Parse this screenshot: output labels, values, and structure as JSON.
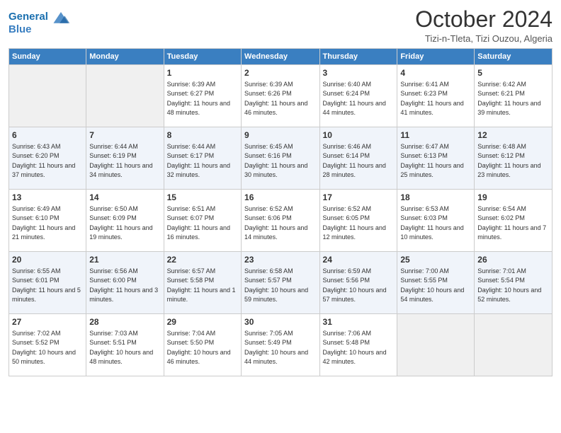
{
  "header": {
    "logo_line1": "General",
    "logo_line2": "Blue",
    "month_title": "October 2024",
    "location": "Tizi-n-Tleta, Tizi Ouzou, Algeria"
  },
  "weekdays": [
    "Sunday",
    "Monday",
    "Tuesday",
    "Wednesday",
    "Thursday",
    "Friday",
    "Saturday"
  ],
  "weeks": [
    [
      {
        "day": "",
        "detail": ""
      },
      {
        "day": "",
        "detail": ""
      },
      {
        "day": "1",
        "detail": "Sunrise: 6:39 AM\nSunset: 6:27 PM\nDaylight: 11 hours and 48 minutes."
      },
      {
        "day": "2",
        "detail": "Sunrise: 6:39 AM\nSunset: 6:26 PM\nDaylight: 11 hours and 46 minutes."
      },
      {
        "day": "3",
        "detail": "Sunrise: 6:40 AM\nSunset: 6:24 PM\nDaylight: 11 hours and 44 minutes."
      },
      {
        "day": "4",
        "detail": "Sunrise: 6:41 AM\nSunset: 6:23 PM\nDaylight: 11 hours and 41 minutes."
      },
      {
        "day": "5",
        "detail": "Sunrise: 6:42 AM\nSunset: 6:21 PM\nDaylight: 11 hours and 39 minutes."
      }
    ],
    [
      {
        "day": "6",
        "detail": "Sunrise: 6:43 AM\nSunset: 6:20 PM\nDaylight: 11 hours and 37 minutes."
      },
      {
        "day": "7",
        "detail": "Sunrise: 6:44 AM\nSunset: 6:19 PM\nDaylight: 11 hours and 34 minutes."
      },
      {
        "day": "8",
        "detail": "Sunrise: 6:44 AM\nSunset: 6:17 PM\nDaylight: 11 hours and 32 minutes."
      },
      {
        "day": "9",
        "detail": "Sunrise: 6:45 AM\nSunset: 6:16 PM\nDaylight: 11 hours and 30 minutes."
      },
      {
        "day": "10",
        "detail": "Sunrise: 6:46 AM\nSunset: 6:14 PM\nDaylight: 11 hours and 28 minutes."
      },
      {
        "day": "11",
        "detail": "Sunrise: 6:47 AM\nSunset: 6:13 PM\nDaylight: 11 hours and 25 minutes."
      },
      {
        "day": "12",
        "detail": "Sunrise: 6:48 AM\nSunset: 6:12 PM\nDaylight: 11 hours and 23 minutes."
      }
    ],
    [
      {
        "day": "13",
        "detail": "Sunrise: 6:49 AM\nSunset: 6:10 PM\nDaylight: 11 hours and 21 minutes."
      },
      {
        "day": "14",
        "detail": "Sunrise: 6:50 AM\nSunset: 6:09 PM\nDaylight: 11 hours and 19 minutes."
      },
      {
        "day": "15",
        "detail": "Sunrise: 6:51 AM\nSunset: 6:07 PM\nDaylight: 11 hours and 16 minutes."
      },
      {
        "day": "16",
        "detail": "Sunrise: 6:52 AM\nSunset: 6:06 PM\nDaylight: 11 hours and 14 minutes."
      },
      {
        "day": "17",
        "detail": "Sunrise: 6:52 AM\nSunset: 6:05 PM\nDaylight: 11 hours and 12 minutes."
      },
      {
        "day": "18",
        "detail": "Sunrise: 6:53 AM\nSunset: 6:03 PM\nDaylight: 11 hours and 10 minutes."
      },
      {
        "day": "19",
        "detail": "Sunrise: 6:54 AM\nSunset: 6:02 PM\nDaylight: 11 hours and 7 minutes."
      }
    ],
    [
      {
        "day": "20",
        "detail": "Sunrise: 6:55 AM\nSunset: 6:01 PM\nDaylight: 11 hours and 5 minutes."
      },
      {
        "day": "21",
        "detail": "Sunrise: 6:56 AM\nSunset: 6:00 PM\nDaylight: 11 hours and 3 minutes."
      },
      {
        "day": "22",
        "detail": "Sunrise: 6:57 AM\nSunset: 5:58 PM\nDaylight: 11 hours and 1 minute."
      },
      {
        "day": "23",
        "detail": "Sunrise: 6:58 AM\nSunset: 5:57 PM\nDaylight: 10 hours and 59 minutes."
      },
      {
        "day": "24",
        "detail": "Sunrise: 6:59 AM\nSunset: 5:56 PM\nDaylight: 10 hours and 57 minutes."
      },
      {
        "day": "25",
        "detail": "Sunrise: 7:00 AM\nSunset: 5:55 PM\nDaylight: 10 hours and 54 minutes."
      },
      {
        "day": "26",
        "detail": "Sunrise: 7:01 AM\nSunset: 5:54 PM\nDaylight: 10 hours and 52 minutes."
      }
    ],
    [
      {
        "day": "27",
        "detail": "Sunrise: 7:02 AM\nSunset: 5:52 PM\nDaylight: 10 hours and 50 minutes."
      },
      {
        "day": "28",
        "detail": "Sunrise: 7:03 AM\nSunset: 5:51 PM\nDaylight: 10 hours and 48 minutes."
      },
      {
        "day": "29",
        "detail": "Sunrise: 7:04 AM\nSunset: 5:50 PM\nDaylight: 10 hours and 46 minutes."
      },
      {
        "day": "30",
        "detail": "Sunrise: 7:05 AM\nSunset: 5:49 PM\nDaylight: 10 hours and 44 minutes."
      },
      {
        "day": "31",
        "detail": "Sunrise: 7:06 AM\nSunset: 5:48 PM\nDaylight: 10 hours and 42 minutes."
      },
      {
        "day": "",
        "detail": ""
      },
      {
        "day": "",
        "detail": ""
      }
    ]
  ]
}
